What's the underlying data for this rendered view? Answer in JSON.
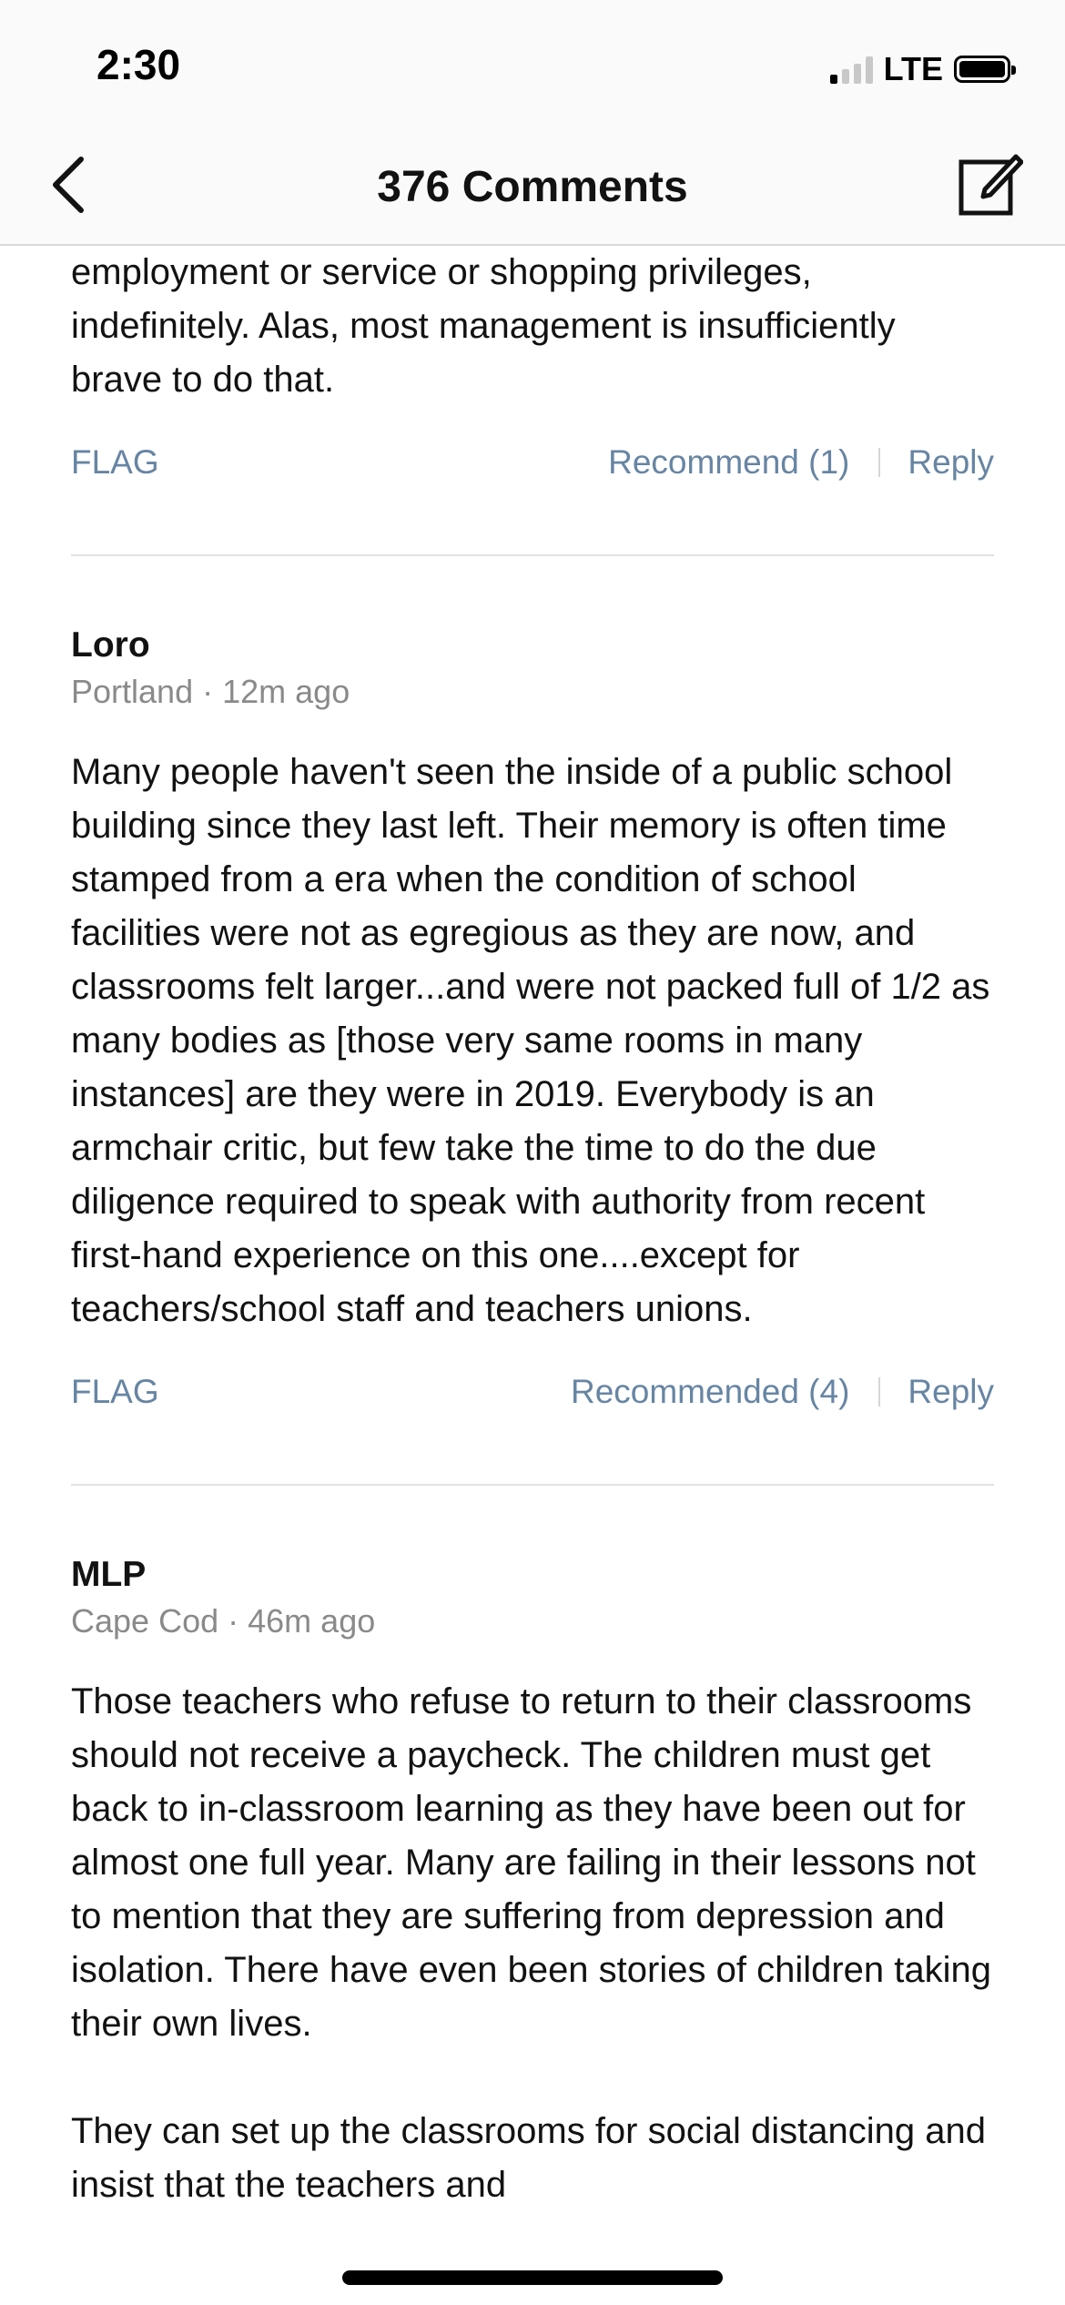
{
  "status_bar": {
    "time": "2:30",
    "network": "LTE"
  },
  "nav": {
    "title": "376 Comments"
  },
  "comments": [
    {
      "body": "employment or service or shopping privileges, indefinitely. Alas, most management is insufficiently brave to do that.",
      "flag_label": "FLAG",
      "recommend_label": "Recommend (1)",
      "reply_label": "Reply"
    },
    {
      "author": "Loro",
      "location": "Portland",
      "time": "12m ago",
      "body": "Many people haven't seen the inside of a public school building since they last left. Their memory is often time stamped from a era when the condition of school facilities were not as egregious as they are now, and classrooms felt larger...and were not packed full of 1/2 as many bodies as [those very same rooms in many instances] are they were in 2019. Everybody is an armchair critic, but few take the time to do the due diligence required to speak with authority from recent first-hand experience on this one....except for teachers/school staff and teachers unions.",
      "flag_label": "FLAG",
      "recommend_label": "Recommended (4)",
      "reply_label": "Reply"
    },
    {
      "author": "MLP",
      "location": "Cape Cod",
      "time": "46m ago",
      "body": "Those teachers who refuse to return to their classrooms should not receive a paycheck. The children must get back to in-classroom learning as they have been out for almost one full year. Many are failing in their lessons not to mention that they are suffering from depression and isolation. There have even been stories of children taking their own lives.",
      "body_2": "They can set up the classrooms for social distancing and insist that the teachers and"
    }
  ],
  "meta_separator": "·",
  "colors": {
    "link": "#6785a3",
    "meta": "#8a8a8a",
    "text": "#121212"
  }
}
